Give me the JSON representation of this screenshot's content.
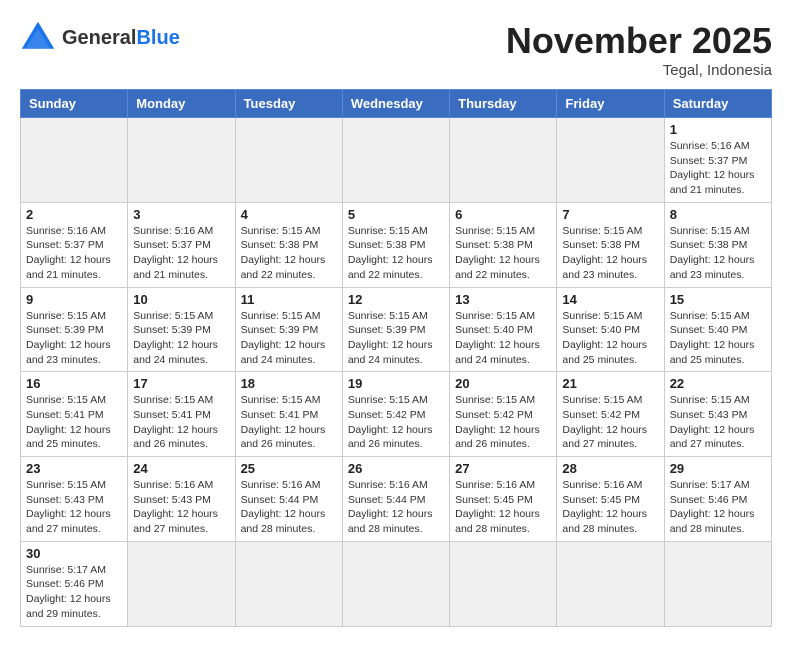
{
  "logo": {
    "general": "General",
    "blue": "Blue"
  },
  "header": {
    "month": "November 2025",
    "location": "Tegal, Indonesia"
  },
  "days_of_week": [
    "Sunday",
    "Monday",
    "Tuesday",
    "Wednesday",
    "Thursday",
    "Friday",
    "Saturday"
  ],
  "weeks": [
    [
      {
        "day": null,
        "info": null
      },
      {
        "day": null,
        "info": null
      },
      {
        "day": null,
        "info": null
      },
      {
        "day": null,
        "info": null
      },
      {
        "day": null,
        "info": null
      },
      {
        "day": null,
        "info": null
      },
      {
        "day": "1",
        "info": "Sunrise: 5:16 AM\nSunset: 5:37 PM\nDaylight: 12 hours\nand 21 minutes."
      }
    ],
    [
      {
        "day": "2",
        "info": "Sunrise: 5:16 AM\nSunset: 5:37 PM\nDaylight: 12 hours\nand 21 minutes."
      },
      {
        "day": "3",
        "info": "Sunrise: 5:16 AM\nSunset: 5:37 PM\nDaylight: 12 hours\nand 21 minutes."
      },
      {
        "day": "4",
        "info": "Sunrise: 5:15 AM\nSunset: 5:38 PM\nDaylight: 12 hours\nand 22 minutes."
      },
      {
        "day": "5",
        "info": "Sunrise: 5:15 AM\nSunset: 5:38 PM\nDaylight: 12 hours\nand 22 minutes."
      },
      {
        "day": "6",
        "info": "Sunrise: 5:15 AM\nSunset: 5:38 PM\nDaylight: 12 hours\nand 22 minutes."
      },
      {
        "day": "7",
        "info": "Sunrise: 5:15 AM\nSunset: 5:38 PM\nDaylight: 12 hours\nand 23 minutes."
      },
      {
        "day": "8",
        "info": "Sunrise: 5:15 AM\nSunset: 5:38 PM\nDaylight: 12 hours\nand 23 minutes."
      }
    ],
    [
      {
        "day": "9",
        "info": "Sunrise: 5:15 AM\nSunset: 5:39 PM\nDaylight: 12 hours\nand 23 minutes."
      },
      {
        "day": "10",
        "info": "Sunrise: 5:15 AM\nSunset: 5:39 PM\nDaylight: 12 hours\nand 24 minutes."
      },
      {
        "day": "11",
        "info": "Sunrise: 5:15 AM\nSunset: 5:39 PM\nDaylight: 12 hours\nand 24 minutes."
      },
      {
        "day": "12",
        "info": "Sunrise: 5:15 AM\nSunset: 5:39 PM\nDaylight: 12 hours\nand 24 minutes."
      },
      {
        "day": "13",
        "info": "Sunrise: 5:15 AM\nSunset: 5:40 PM\nDaylight: 12 hours\nand 24 minutes."
      },
      {
        "day": "14",
        "info": "Sunrise: 5:15 AM\nSunset: 5:40 PM\nDaylight: 12 hours\nand 25 minutes."
      },
      {
        "day": "15",
        "info": "Sunrise: 5:15 AM\nSunset: 5:40 PM\nDaylight: 12 hours\nand 25 minutes."
      }
    ],
    [
      {
        "day": "16",
        "info": "Sunrise: 5:15 AM\nSunset: 5:41 PM\nDaylight: 12 hours\nand 25 minutes."
      },
      {
        "day": "17",
        "info": "Sunrise: 5:15 AM\nSunset: 5:41 PM\nDaylight: 12 hours\nand 26 minutes."
      },
      {
        "day": "18",
        "info": "Sunrise: 5:15 AM\nSunset: 5:41 PM\nDaylight: 12 hours\nand 26 minutes."
      },
      {
        "day": "19",
        "info": "Sunrise: 5:15 AM\nSunset: 5:42 PM\nDaylight: 12 hours\nand 26 minutes."
      },
      {
        "day": "20",
        "info": "Sunrise: 5:15 AM\nSunset: 5:42 PM\nDaylight: 12 hours\nand 26 minutes."
      },
      {
        "day": "21",
        "info": "Sunrise: 5:15 AM\nSunset: 5:42 PM\nDaylight: 12 hours\nand 27 minutes."
      },
      {
        "day": "22",
        "info": "Sunrise: 5:15 AM\nSunset: 5:43 PM\nDaylight: 12 hours\nand 27 minutes."
      }
    ],
    [
      {
        "day": "23",
        "info": "Sunrise: 5:15 AM\nSunset: 5:43 PM\nDaylight: 12 hours\nand 27 minutes."
      },
      {
        "day": "24",
        "info": "Sunrise: 5:16 AM\nSunset: 5:43 PM\nDaylight: 12 hours\nand 27 minutes."
      },
      {
        "day": "25",
        "info": "Sunrise: 5:16 AM\nSunset: 5:44 PM\nDaylight: 12 hours\nand 28 minutes."
      },
      {
        "day": "26",
        "info": "Sunrise: 5:16 AM\nSunset: 5:44 PM\nDaylight: 12 hours\nand 28 minutes."
      },
      {
        "day": "27",
        "info": "Sunrise: 5:16 AM\nSunset: 5:45 PM\nDaylight: 12 hours\nand 28 minutes."
      },
      {
        "day": "28",
        "info": "Sunrise: 5:16 AM\nSunset: 5:45 PM\nDaylight: 12 hours\nand 28 minutes."
      },
      {
        "day": "29",
        "info": "Sunrise: 5:17 AM\nSunset: 5:46 PM\nDaylight: 12 hours\nand 28 minutes."
      }
    ],
    [
      {
        "day": "30",
        "info": "Sunrise: 5:17 AM\nSunset: 5:46 PM\nDaylight: 12 hours\nand 29 minutes."
      },
      {
        "day": null,
        "info": null
      },
      {
        "day": null,
        "info": null
      },
      {
        "day": null,
        "info": null
      },
      {
        "day": null,
        "info": null
      },
      {
        "day": null,
        "info": null
      },
      {
        "day": null,
        "info": null
      }
    ]
  ]
}
